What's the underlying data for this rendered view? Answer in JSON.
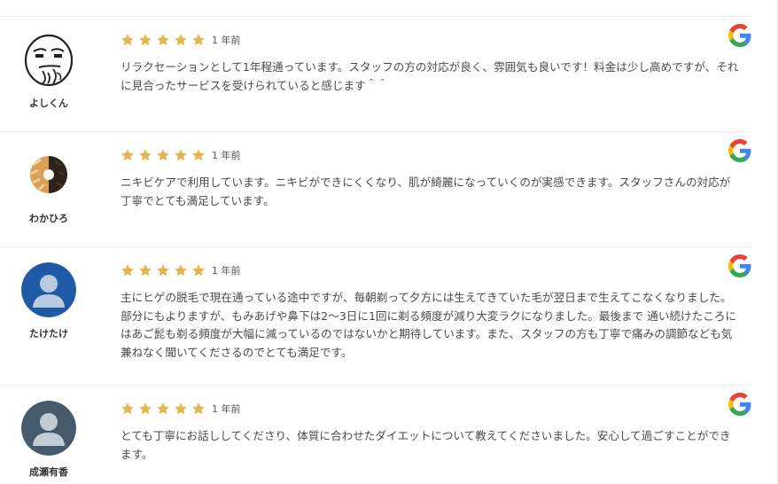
{
  "colors": {
    "star": "#e3b74f",
    "separator": "#ececec"
  },
  "reviews": [
    {
      "name": "よしくん",
      "avatar": "cartoon-face",
      "rating": 5,
      "time": "1 年前",
      "source_icon": "google-icon",
      "text": "リラクセーションとして1年程通っています。スタッフの方の対応が良く、雰囲気も良いです！料金は少し高めですが、それに見合ったサービスを受けられていると感じます＾＾"
    },
    {
      "name": "わかひろ",
      "avatar": "donut-photo",
      "rating": 5,
      "time": "1 年前",
      "source_icon": "google-icon",
      "text": "ニキビケアで利用しています。ニキビができにくくなり、肌が綺麗になっていくのが実感できます。スタッフさんの対応が丁寧でとても満足しています。"
    },
    {
      "name": "たけたけ",
      "avatar": "default-user-blue",
      "rating": 5,
      "time": "1 年前",
      "source_icon": "google-icon",
      "text": "主にヒゲの脱毛で現在通っている途中ですが、毎朝剃って夕方には生えてきていた毛が翌日まで生えてこなくなりました。部分にもよりますが、もみあげや鼻下は2～3日に1回に剃る頻度が減り大変ラクになりました。最後まで 通い続けたころにはあご髭も剃る頻度が大幅に減っているのではないかと期待しています。また、スタッフの方も丁寧で痛みの調節なども気兼ねなく聞いてくださるのでとても満足です。"
    },
    {
      "name": "成瀬有香",
      "avatar": "default-user-gray",
      "rating": 5,
      "time": "1 年前",
      "source_icon": "google-icon",
      "text": "とても丁寧にお話ししてくださり、体質に合わせたダイエットについて教えてくださいました。安心して過ごすことができます。"
    }
  ]
}
